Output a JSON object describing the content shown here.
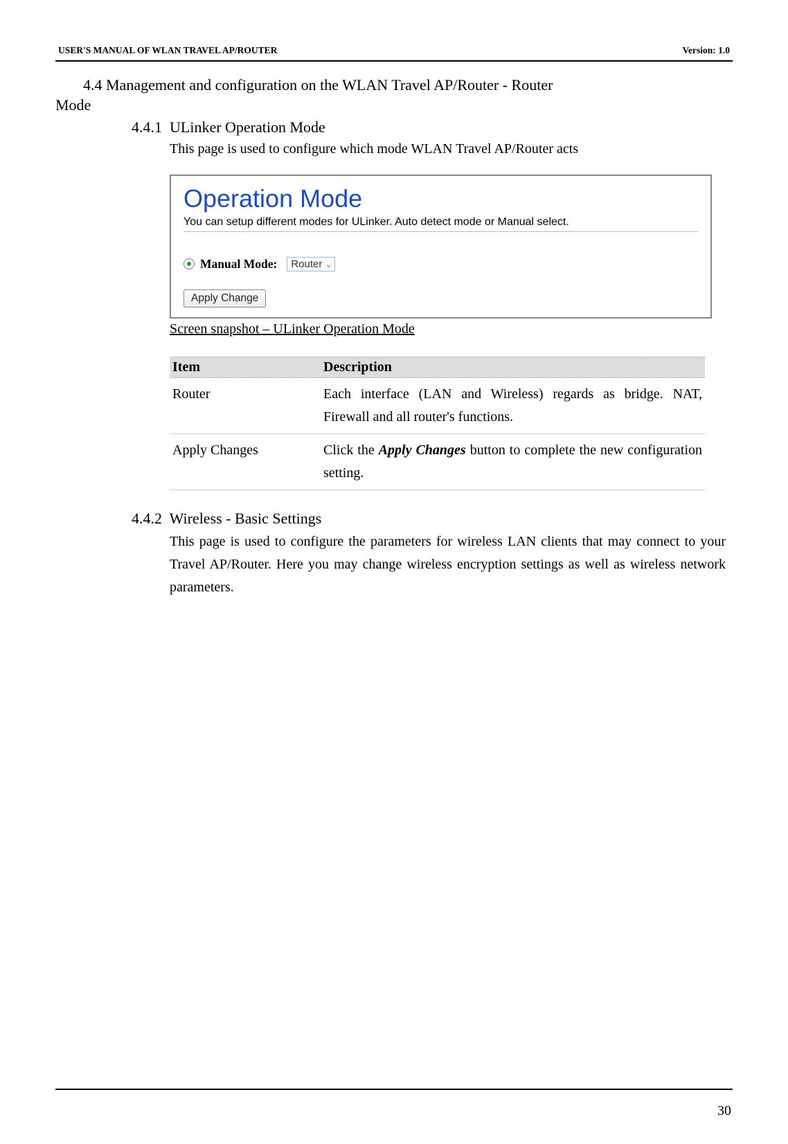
{
  "header": {
    "left": "USER'S MANUAL OF WLAN TRAVEL AP/ROUTER",
    "right": "Version: 1.0"
  },
  "sections": {
    "s44": {
      "num": "4.4 ",
      "title_line1": "Management and configuration on the WLAN Travel AP/Router - Router",
      "title_line2": "Mode"
    },
    "s441": {
      "num": "4.4.1",
      "title": "ULinker Operation Mode",
      "desc": "This page is used to configure which mode WLAN Travel AP/Router acts"
    },
    "s442": {
      "num": "4.4.2",
      "title": "Wireless - Basic Settings",
      "desc": "This page is used to configure the parameters for wireless LAN clients that may connect to your Travel AP/Router. Here you may change wireless encryption settings as well as wireless network parameters."
    }
  },
  "screenshot": {
    "title": "Operation Mode",
    "subtext": "You can setup different modes for ULinker. Auto detect mode or Manual select.",
    "manual_label": "Manual Mode:",
    "select_value": "Router",
    "apply_btn": "Apply Change",
    "caption": "Screen snapshot – ULinker Operation Mode"
  },
  "table": {
    "headers": [
      "Item",
      "Description"
    ],
    "rows": [
      {
        "item": "Router",
        "description": "Each interface (LAN and Wireless) regards as bridge. NAT, Firewall and all router's functions."
      },
      {
        "item": "Apply Changes",
        "desc_pre": "Click the ",
        "desc_bold": "Apply Changes",
        "desc_post": " button to complete the new configuration setting."
      }
    ]
  },
  "footer": {
    "page": "30"
  }
}
